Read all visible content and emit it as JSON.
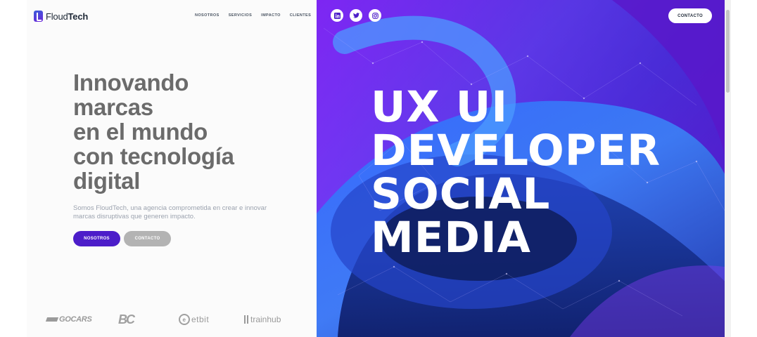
{
  "brand": {
    "logo_regular": "Floud",
    "logo_bold": "Tech"
  },
  "nav": {
    "items": [
      {
        "label": "NOSOTROS"
      },
      {
        "label": "SERVICIOS"
      },
      {
        "label": "IMPACTO"
      },
      {
        "label": "CLIENTES"
      }
    ]
  },
  "hero": {
    "title_lines": [
      "Innovando",
      "marcas",
      "en el mundo",
      "con tecnología",
      "digital"
    ],
    "description": "Somos FloudTech, una agencia comprometida en crear e innovar marcas disruptivas que generen impacto.",
    "primary_button": "NOSOTROS",
    "secondary_button": "CONTACTO"
  },
  "clients": {
    "gocars": "GOCARS",
    "bc": "BC",
    "etbit": "etbit",
    "etbit_mark": "e",
    "trainhub": "trainhub"
  },
  "right": {
    "social": [
      {
        "icon": "linkedin-icon"
      },
      {
        "icon": "twitter-icon"
      },
      {
        "icon": "instagram-icon"
      }
    ],
    "contact_button": "CONTACTO",
    "big_lines": [
      "UX UI",
      "DEVELOPER",
      "SOCIAL",
      "MEDIA"
    ]
  },
  "colors": {
    "primary": "#4c1dc9",
    "secondary_button": "#b3b3b3",
    "title_gray": "#6b6b6b",
    "panel_purple": "#6d1ff0",
    "panel_blue": "#3a3be0"
  }
}
